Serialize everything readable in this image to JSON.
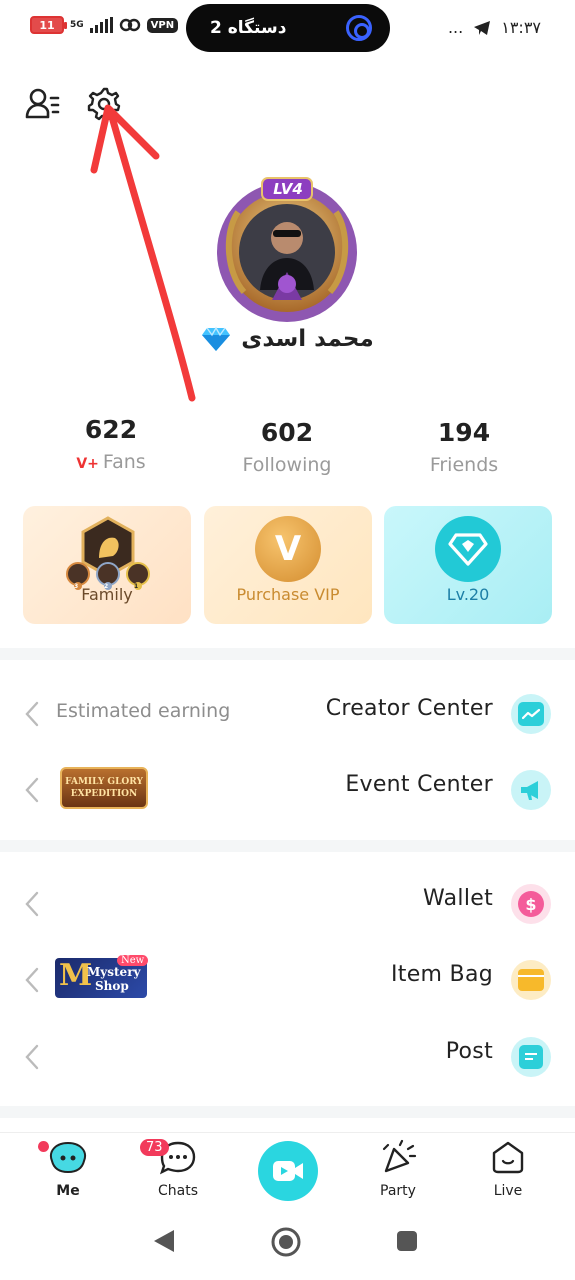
{
  "status_bar": {
    "battery": "11",
    "network": "5G",
    "vpn": "VPN",
    "island_text": "2 دستگاه",
    "time": "۱۳:۳۷",
    "more": "..."
  },
  "profile": {
    "level_badge": "LV4",
    "name": "محمد اسدی"
  },
  "stats": [
    {
      "value": "622",
      "label": "Fans",
      "prefix": "V+"
    },
    {
      "value": "602",
      "label": "Following"
    },
    {
      "value": "194",
      "label": "Friends"
    }
  ],
  "cards": {
    "family": {
      "label": "Family",
      "ranks": [
        "3",
        "2",
        "1"
      ]
    },
    "vip": {
      "label": "Purchase VIP",
      "letter": "V"
    },
    "level": {
      "label": "Lv.20"
    }
  },
  "menu": {
    "creator_center": {
      "title": "Creator Center",
      "sub": "Estimated earning"
    },
    "event_center": {
      "title": "Event Center",
      "banner_line1": "FAMILY GLORY",
      "banner_line2": "EXPEDITION"
    },
    "wallet": {
      "title": "Wallet"
    },
    "item_bag": {
      "title": "Item Bag",
      "banner_letter": "M",
      "banner_line1": "Mystery",
      "banner_line2": "Shop",
      "banner_badge": "New"
    },
    "post": {
      "title": "Post"
    }
  },
  "nav": {
    "me": "Me",
    "chats": "Chats",
    "chats_badge": "73",
    "party": "Party",
    "live": "Live"
  },
  "colors": {
    "accent_teal": "#2ad6e0",
    "annotation_red": "#f23a3a",
    "vip_gold": "#d99a3c"
  }
}
